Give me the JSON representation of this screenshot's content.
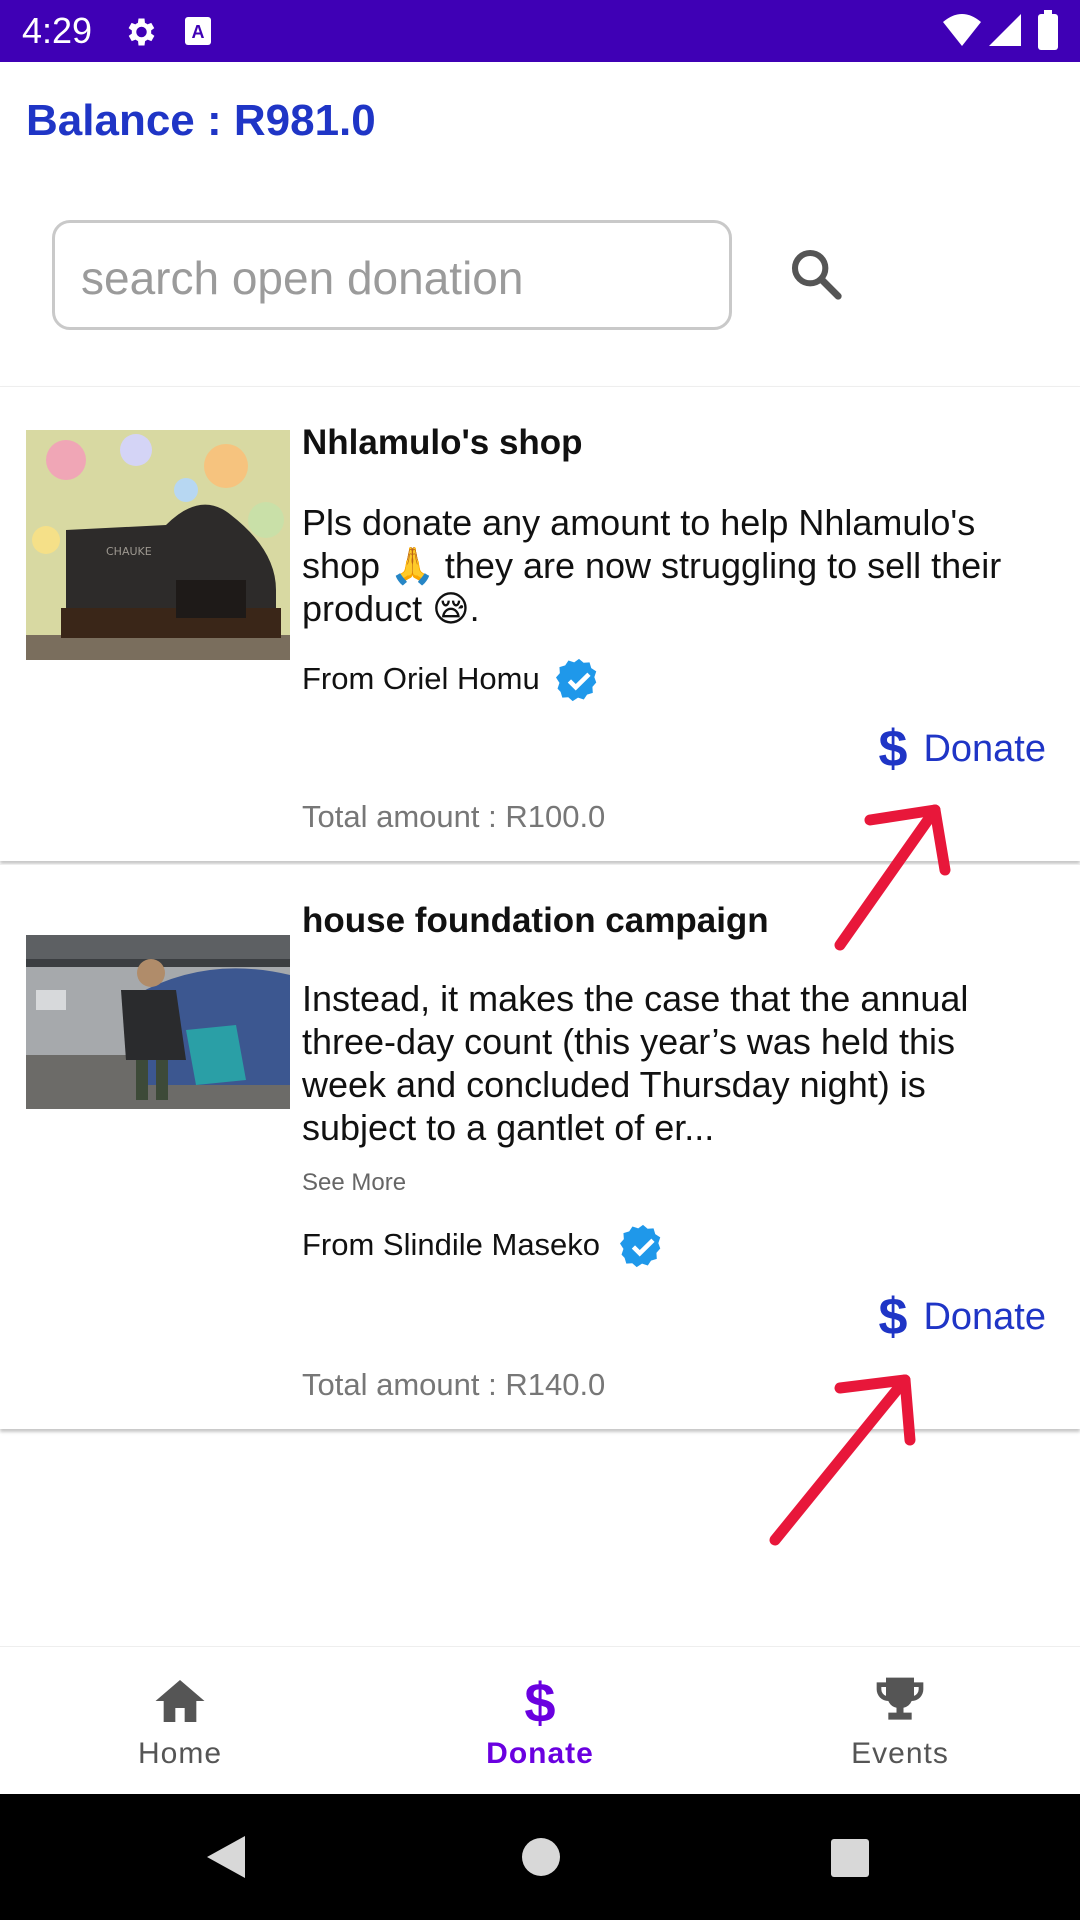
{
  "status_bar": {
    "time": "4:29",
    "icons": [
      "gear-icon",
      "font-a-icon",
      "wifi-icon",
      "cell-signal-icon",
      "battery-icon"
    ],
    "background": "#3f00b5"
  },
  "balance": {
    "text": "Balance : R981.0",
    "color": "#1f35c6"
  },
  "search": {
    "placeholder": "search open donation",
    "value": "",
    "icon": "search-icon"
  },
  "donations": [
    {
      "title": "Nhlamulo's shop",
      "description": "Pls donate any amount to help Nhlamulo's shop 🙏 they are now struggling to sell their product  😪.",
      "from": "From Oriel Homu",
      "verified": true,
      "donate_label": "Donate",
      "total": "Total amount : R100.0",
      "image": "shoe-photo"
    },
    {
      "title": "house foundation campaign",
      "description": "Instead, it makes the case that the annual three-day count (this year’s was held this week and concluded Thursday night) is subject to a gantlet of er...",
      "see_more": "See More",
      "from": "From Slindile Maseko",
      "verified": true,
      "donate_label": "Donate",
      "total": "Total amount : R140.0",
      "image": "homeless-camp-photo"
    }
  ],
  "annotations": {
    "arrow_color": "#e8173a"
  },
  "bottom_nav": {
    "items": [
      {
        "label": "Home",
        "icon": "home-icon",
        "active": false
      },
      {
        "label": "Donate",
        "icon": "dollar-icon",
        "active": true
      },
      {
        "label": "Events",
        "icon": "trophy-icon",
        "active": false
      }
    ],
    "active_color": "#6a00e0"
  },
  "system_nav": {
    "buttons": [
      "back-icon",
      "home-circle-icon",
      "recents-icon"
    ]
  }
}
